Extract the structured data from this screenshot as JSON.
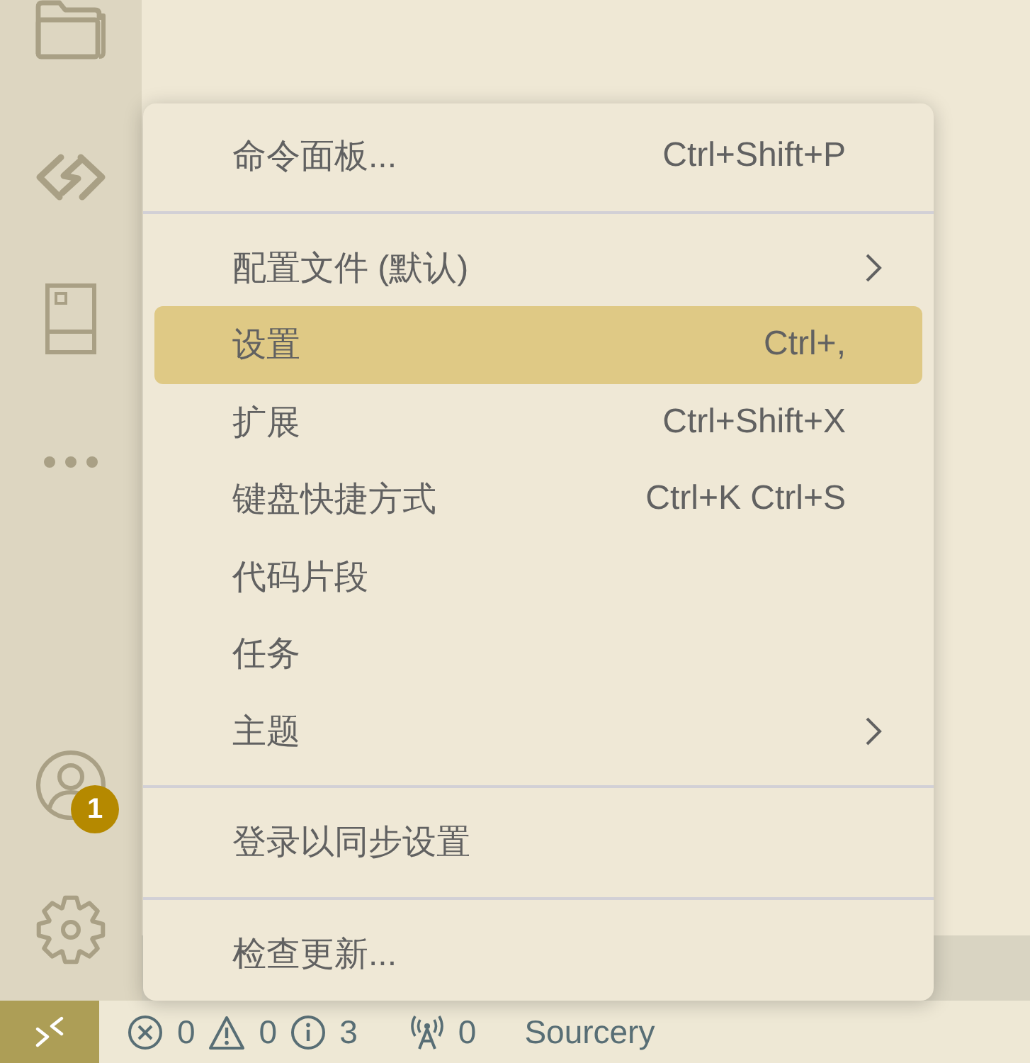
{
  "activity_bar": {
    "account_badge": "1"
  },
  "menu": {
    "items": [
      {
        "kind": "command",
        "label": "命令面板...",
        "shortcut": "Ctrl+Shift+P",
        "selected": false
      },
      {
        "kind": "separator"
      },
      {
        "kind": "submenu",
        "label": "配置文件 (默认)",
        "selected": false
      },
      {
        "kind": "command",
        "label": "设置",
        "shortcut": "Ctrl+,",
        "selected": true
      },
      {
        "kind": "command",
        "label": "扩展",
        "shortcut": "Ctrl+Shift+X",
        "selected": false
      },
      {
        "kind": "command",
        "label": "键盘快捷方式",
        "shortcut": "Ctrl+K Ctrl+S",
        "selected": false
      },
      {
        "kind": "command",
        "label": "代码片段",
        "selected": false
      },
      {
        "kind": "command",
        "label": "任务",
        "selected": false
      },
      {
        "kind": "submenu",
        "label": "主题",
        "selected": false
      },
      {
        "kind": "separator"
      },
      {
        "kind": "command",
        "label": "登录以同步设置",
        "selected": false
      },
      {
        "kind": "separator"
      },
      {
        "kind": "command",
        "label": "检查更新...",
        "selected": false
      }
    ]
  },
  "status_bar": {
    "errors": "0",
    "warnings": "0",
    "infos": "3",
    "ports": "0",
    "extension": "Sourcery"
  }
}
